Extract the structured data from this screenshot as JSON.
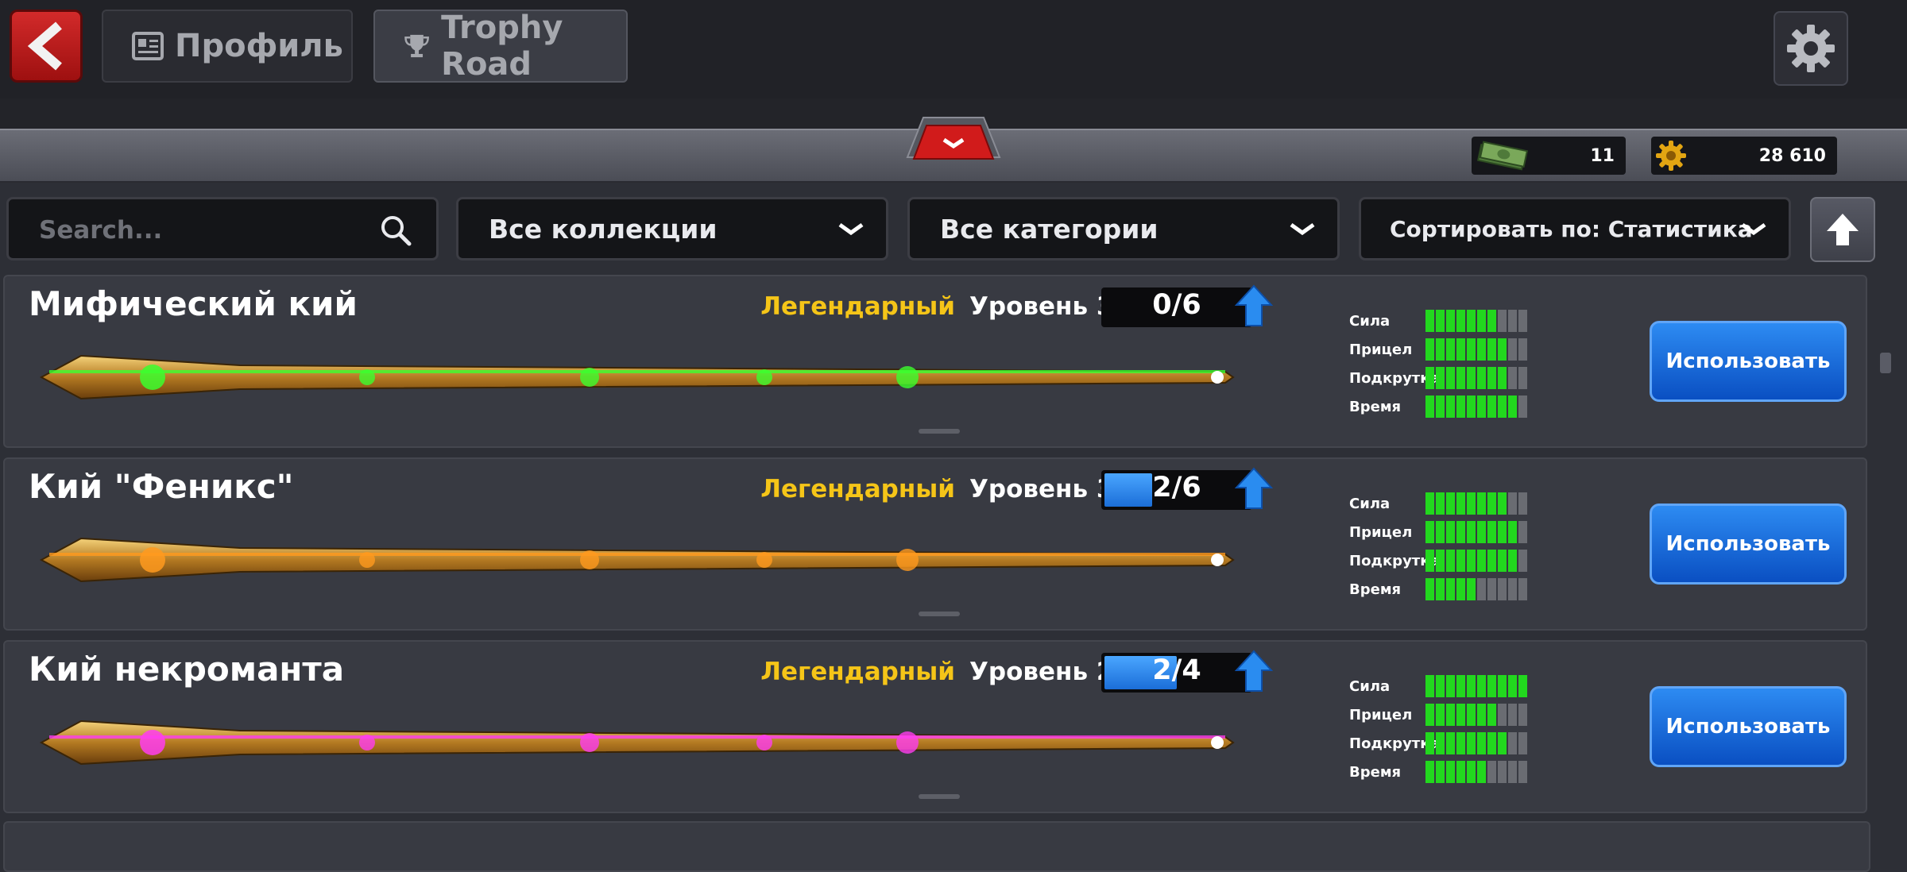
{
  "header": {
    "back_icon": "back-chevron-icon",
    "tabs": [
      {
        "label": "Профиль",
        "icon": "profile-card-icon",
        "active": false
      },
      {
        "label": "Trophy Road",
        "icon": "trophy-icon",
        "active": true
      }
    ],
    "settings_icon": "gear-icon"
  },
  "currency": {
    "cash": {
      "icon": "cash-stack-icon",
      "value": "11"
    },
    "coins": {
      "icon": "coin-icon",
      "value": "28 610"
    }
  },
  "filters": {
    "search_placeholder": "Search...",
    "collections": "Все коллекции",
    "categories": "Все категории",
    "sort": "Сортировать по: Статистика"
  },
  "cues": [
    {
      "name": "Мифический кий",
      "rarity": "Легендарный",
      "level": "Уровень 3",
      "progress_text": "0/6",
      "progress_fraction": 0.0,
      "glow_color": "#3bff2e",
      "stats": [
        {
          "label": "Сила",
          "value": 7,
          "max": 10
        },
        {
          "label": "Прицел",
          "value": 8,
          "max": 10
        },
        {
          "label": "Подкрутка",
          "value": 8,
          "max": 10
        },
        {
          "label": "Время",
          "value": 9,
          "max": 10
        }
      ],
      "use_label": "Использовать"
    },
    {
      "name": "Кий \"Феникс\"",
      "rarity": "Легендарный",
      "level": "Уровень 3",
      "progress_text": "2/6",
      "progress_fraction": 0.33,
      "glow_color": "#ff9a1e",
      "stats": [
        {
          "label": "Сила",
          "value": 8,
          "max": 10
        },
        {
          "label": "Прицел",
          "value": 9,
          "max": 10
        },
        {
          "label": "Подкрутка",
          "value": 9,
          "max": 10
        },
        {
          "label": "Время",
          "value": 5,
          "max": 10
        }
      ],
      "use_label": "Использовать"
    },
    {
      "name": "Кий некроманта",
      "rarity": "Легендарный",
      "level": "Уровень 2",
      "progress_text": "2/4",
      "progress_fraction": 0.5,
      "glow_color": "#ff3df0",
      "stats": [
        {
          "label": "Сила",
          "value": 10,
          "max": 10
        },
        {
          "label": "Прицел",
          "value": 7,
          "max": 10
        },
        {
          "label": "Подкрутка",
          "value": 8,
          "max": 10
        },
        {
          "label": "Время",
          "value": 6,
          "max": 10
        }
      ],
      "use_label": "Использовать"
    }
  ]
}
